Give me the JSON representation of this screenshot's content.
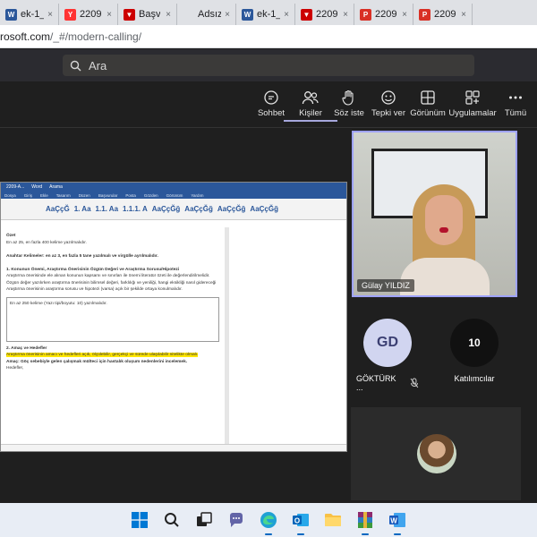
{
  "browser": {
    "tabs": [
      {
        "label": "ek-1_",
        "icon": "word-icon",
        "color": "#2b579a",
        "glyph": "W"
      },
      {
        "label": "2209",
        "icon": "yandex-icon",
        "color": "#f33",
        "glyph": "Y"
      },
      {
        "label": "Başv",
        "icon": "app-icon",
        "color": "#c00",
        "glyph": "▼"
      },
      {
        "label": "Adsız",
        "icon": "",
        "color": "",
        "glyph": ""
      },
      {
        "label": "ek-1_",
        "icon": "word-icon",
        "color": "#2b579a",
        "glyph": "W"
      },
      {
        "label": "2209",
        "icon": "app-icon",
        "color": "#c00",
        "glyph": "▼"
      },
      {
        "label": "2209",
        "icon": "pdf-icon",
        "color": "#d93025",
        "glyph": "P"
      },
      {
        "label": "2209",
        "icon": "pdf-icon",
        "color": "#d93025",
        "glyph": "P"
      }
    ],
    "address_domain": "rosoft.com",
    "address_path": "/_#/modern-calling/"
  },
  "teams": {
    "search_placeholder": "Ara",
    "toolbar": [
      {
        "label": "Sohbet",
        "icon": "chat-icon"
      },
      {
        "label": "Kişiler",
        "icon": "people-icon"
      },
      {
        "label": "Söz iste",
        "icon": "raise-hand-icon"
      },
      {
        "label": "Tepki ver",
        "icon": "reaction-icon"
      },
      {
        "label": "Görünüm",
        "icon": "view-icon"
      },
      {
        "label": "Uygulamalar",
        "icon": "apps-icon"
      },
      {
        "label": "Tümü",
        "icon": "more-icon"
      }
    ],
    "speaker_name": "Gülay YILDIZ",
    "participant": {
      "initials": "GD",
      "name": "GÖKTÜRK ...",
      "color": "#d1d5f0"
    },
    "participants_count": {
      "count": "10",
      "label": "Katılımcılar"
    }
  },
  "doc": {
    "title_items": [
      "2209-A...",
      "Word",
      "Arama"
    ],
    "menu": [
      "Dosya",
      "Giriş",
      "Ekle",
      "Tasarım",
      "Düzen",
      "Başvurular",
      "Posta",
      "Gözden",
      "Görünüm",
      "Yardım"
    ],
    "styles": [
      "AaÇçĞ",
      "1. Aa",
      "1.1. Aa",
      "1.1.1. A",
      "AaÇçĞğ",
      "AaÇçĞğ",
      "AaÇçĞğ",
      "AaÇçĞğ"
    ],
    "lines": [
      {
        "text": "Özet",
        "cls": "b"
      },
      {
        "text": "En az 25, en fazla 400 kelime yazılmalıdır.",
        "cls": ""
      },
      {
        "text": "",
        "cls": ""
      },
      {
        "text": "Anahtar Kelimeler: en az 3, en fazla 5 tane yazılmalı ve virgülle ayrılmalıdır.",
        "cls": "b"
      },
      {
        "text": "",
        "cls": ""
      },
      {
        "text": "1. Konunun Önemi, Araştırma Önerisinin Özgün Değeri ve Araştırma Sorusu/Hipotezi",
        "cls": "b"
      },
      {
        "text": "Araştırma önerisinde ele alınan konunun kapsamı ve sınırları ile önemi literatür özeti ile değerlendirilmelidir.",
        "cls": ""
      },
      {
        "text": "Özgün değer yazılırken araştırma önerisinin bilimsel değeri, farklılığı ve yeniliği, hangi eksikliği nasıl gidereceği",
        "cls": ""
      },
      {
        "text": "Araştırma önerisinin araştırma sorusu ve hipotezi (varsa) açık bir şekilde ortaya konulmalıdır.",
        "cls": ""
      },
      {
        "text": "En az 250 kelime (Yazı tipi/boyutu: 10) yazılmalıdır.",
        "cls": "box"
      },
      {
        "text": "2. Amaç ve Hedefler",
        "cls": "b"
      },
      {
        "text": "Araştırma önerisinin amacı ve hedefleri açık, ölçülebilir, gerçekçi ve sürede ulaşılabilir nitelikte olmalı.",
        "cls": "hl"
      },
      {
        "text": "Amaç: Göç sebebiyle gelen çalışmak mülteci için hastalık oluşum nedenlerini incelemek.",
        "cls": "b"
      },
      {
        "text": "Hedefler,",
        "cls": ""
      }
    ]
  }
}
